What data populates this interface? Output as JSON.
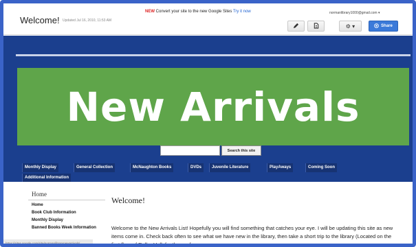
{
  "header": {
    "title": "Welcome!",
    "updated": "Updated Jul 16, 2010, 11:53 AM",
    "promo_new": "NEW",
    "promo_text": "Convert your site to the new Google Sites",
    "promo_link": "Try it now",
    "email": "normanlibrary1000@gmail.com ▾",
    "edit_icon": "pencil-icon",
    "page_icon": "new-page-icon",
    "settings_label": "⚙ ▾",
    "share_label": "Share"
  },
  "banner": {
    "text": "New Arrivals"
  },
  "search": {
    "button_label": "Search this site",
    "value": ""
  },
  "nav": {
    "items": [
      "Monthly Display",
      "General Collection",
      "McNaughton Books",
      "DVDs",
      "Juvenile Literature",
      "PlayAways",
      "Coming Soon",
      "Additional Information"
    ]
  },
  "sidebar": {
    "heading": "Home",
    "items": [
      "Home",
      "Book Club Information",
      "Monthly Display",
      "Banned Books Week Information"
    ]
  },
  "main": {
    "title": "Welcome!",
    "text": "Welcome to the New Arrivals List!  Hopefully you will find something that catches your eye. I will be updating this site as new items come in. Check back often to see what we have new in the library, then take a short trip to the library (Located on the first floor of Roller Hall, for those of"
  },
  "status": {
    "url": "https://sites.google.com/site/normanlibrarynewarrivals/"
  },
  "colors": {
    "site_bg": "#1b3f8e",
    "banner_bg": "#5fa54a",
    "share_bg": "#3b7ad9",
    "frame": "#3a63c8"
  }
}
